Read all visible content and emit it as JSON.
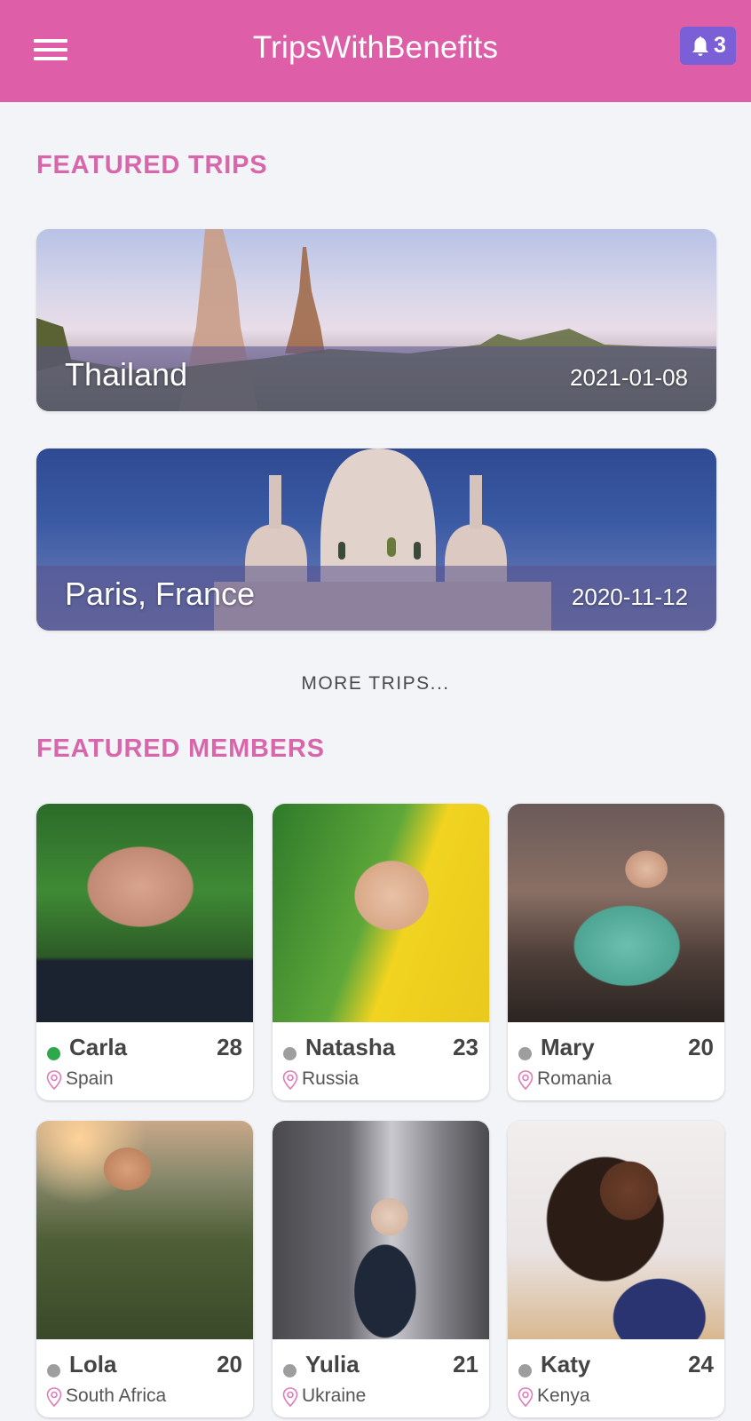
{
  "header": {
    "title": "TripsWithBenefits",
    "notifications_count": "3",
    "menu_icon": "hamburger-menu-icon",
    "notification_icon": "bell-icon",
    "brand_color": "#de5fa8",
    "badge_color": "#7b5fd6"
  },
  "featured_trips": {
    "title": "FEATURED TRIPS",
    "trips": [
      {
        "name": "Thailand",
        "date": "2021-01-08"
      },
      {
        "name": "Paris, France",
        "date": "2020-11-12"
      }
    ],
    "more_label": "MORE TRIPS..."
  },
  "featured_members": {
    "title": "FEATURED MEMBERS",
    "status_colors": {
      "online": "#2ea84a",
      "offline": "#9e9e9e"
    },
    "members": [
      {
        "name": "Carla",
        "age": "28",
        "country": "Spain",
        "status": "online"
      },
      {
        "name": "Natasha",
        "age": "23",
        "country": "Russia",
        "status": "offline"
      },
      {
        "name": "Mary",
        "age": "20",
        "country": "Romania",
        "status": "offline"
      },
      {
        "name": "Lola",
        "age": "20",
        "country": "South Africa",
        "status": "offline"
      },
      {
        "name": "Yulia",
        "age": "21",
        "country": "Ukraine",
        "status": "offline"
      },
      {
        "name": "Katy",
        "age": "24",
        "country": "Kenya",
        "status": "offline"
      }
    ]
  }
}
